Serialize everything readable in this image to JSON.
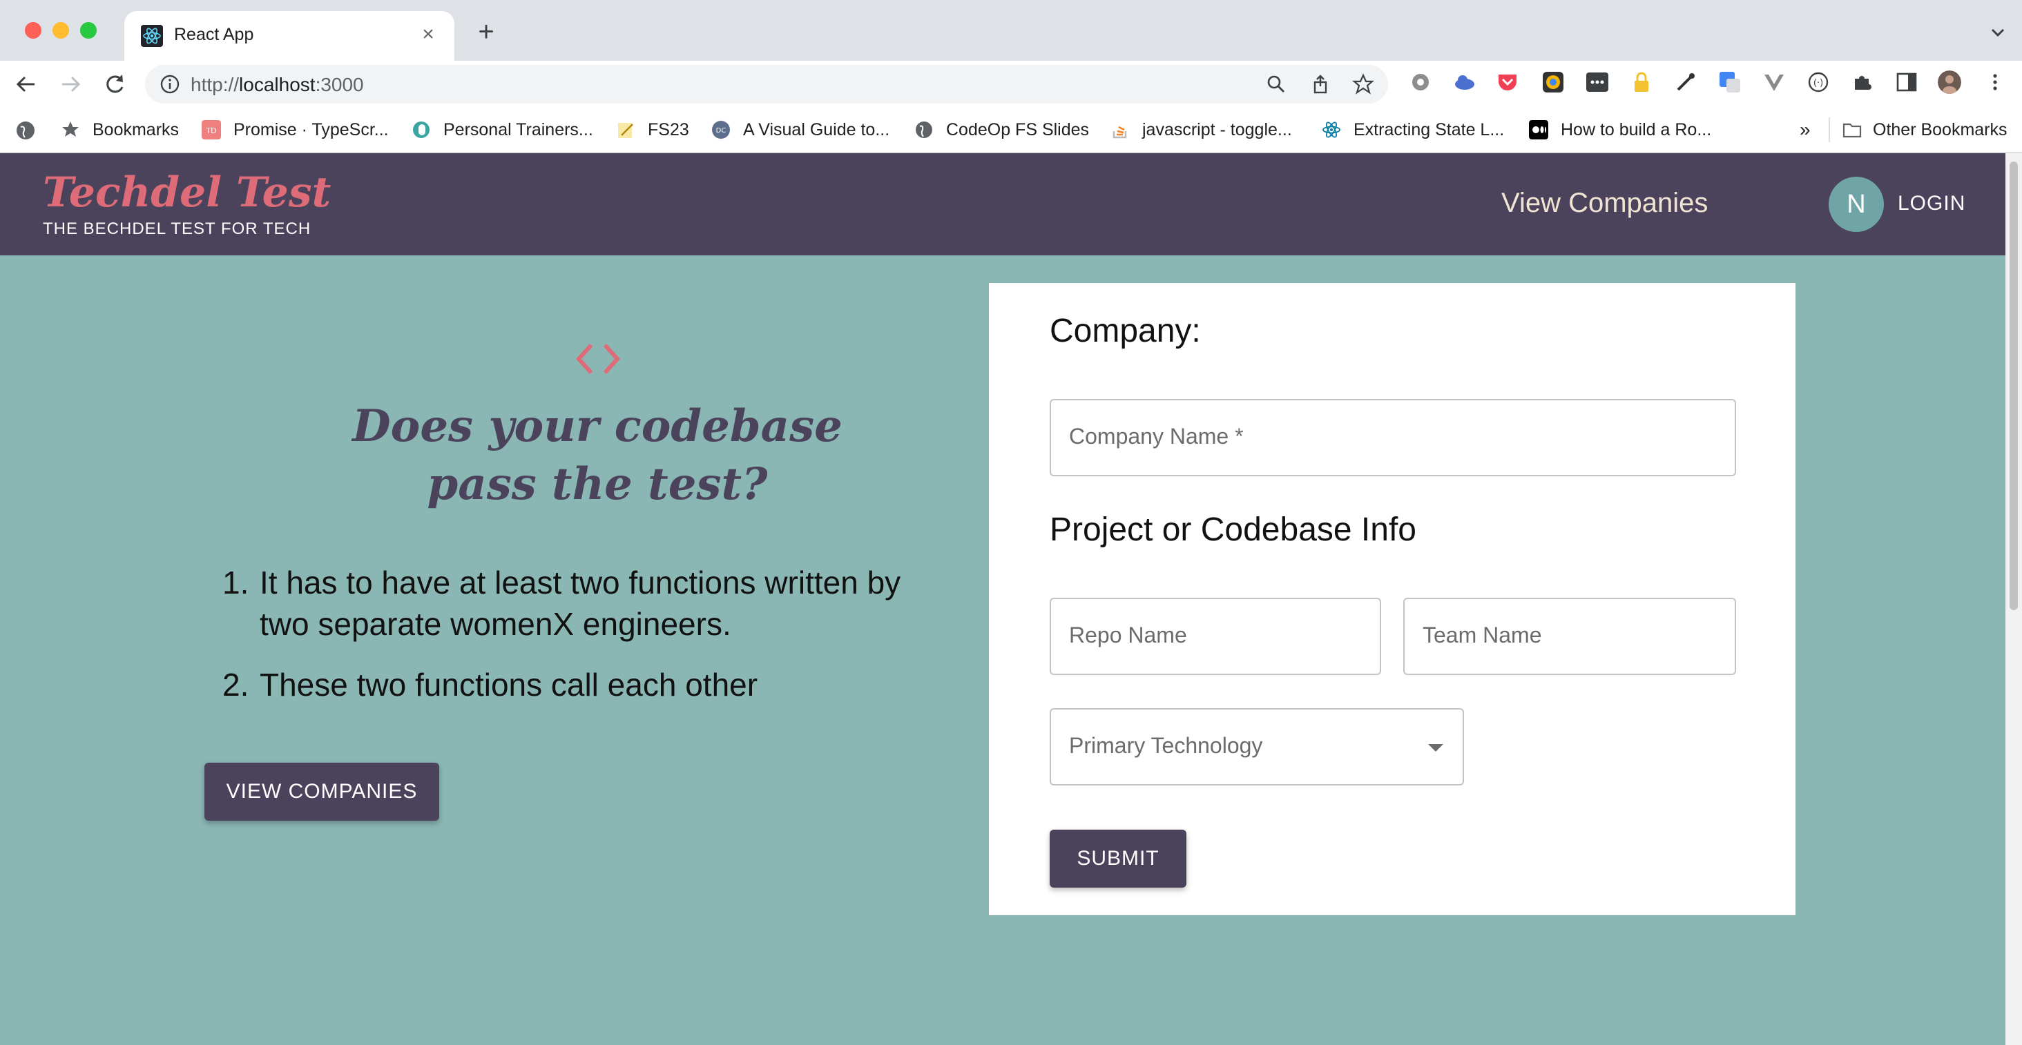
{
  "browser": {
    "tab_title": "React App",
    "url_prefix": "http://",
    "url_host": "localhost",
    "url_suffix": ":3000"
  },
  "bookmarks": [
    {
      "label": "Bookmarks",
      "icon": "star-icon"
    },
    {
      "label": "Promise · TypeScr...",
      "icon": "td-favicon"
    },
    {
      "label": "Personal Trainers...",
      "icon": "d-favicon"
    },
    {
      "label": "FS23",
      "icon": "notepad-favicon"
    },
    {
      "label": "A Visual Guide to...",
      "icon": "dc-favicon"
    },
    {
      "label": "CodeOp FS Slides",
      "icon": "globe-icon"
    },
    {
      "label": "javascript - toggle...",
      "icon": "stackoverflow-favicon"
    },
    {
      "label": "Extracting State L...",
      "icon": "react-favicon"
    },
    {
      "label": "How to build a Ro...",
      "icon": "medium-favicon"
    },
    {
      "label": "Other Bookmarks",
      "icon": "folder-icon"
    }
  ],
  "bookmarks_overflow": "»",
  "header": {
    "brand_title": "Techdel Test",
    "brand_subtitle": "THE BECHDEL TEST FOR TECH",
    "nav_view_companies": "View Companies",
    "avatar_initial": "N",
    "login": "LOGIN"
  },
  "hero": {
    "headline_line1": "Does your codebase",
    "headline_line2": "pass the test?",
    "rules": [
      {
        "num": "1.",
        "text": "It has to have at least two functions written by two separate womenX engineers."
      },
      {
        "num": "2.",
        "text": "These two functions call each other"
      }
    ],
    "cta": "VIEW COMPANIES"
  },
  "form": {
    "company_heading": "Company:",
    "company_name_label": "Company Name *",
    "project_heading": "Project or Codebase Info",
    "repo_label": "Repo Name",
    "team_label": "Team Name",
    "tech_label": "Primary Technology",
    "submit": "SUBMIT"
  },
  "colors": {
    "page_bg": "#8ab6b4",
    "header_bg": "#4b435b",
    "brand": "#de6b78",
    "nav_text": "#f2e4d2",
    "avatar_bg": "#6fa5a7"
  }
}
